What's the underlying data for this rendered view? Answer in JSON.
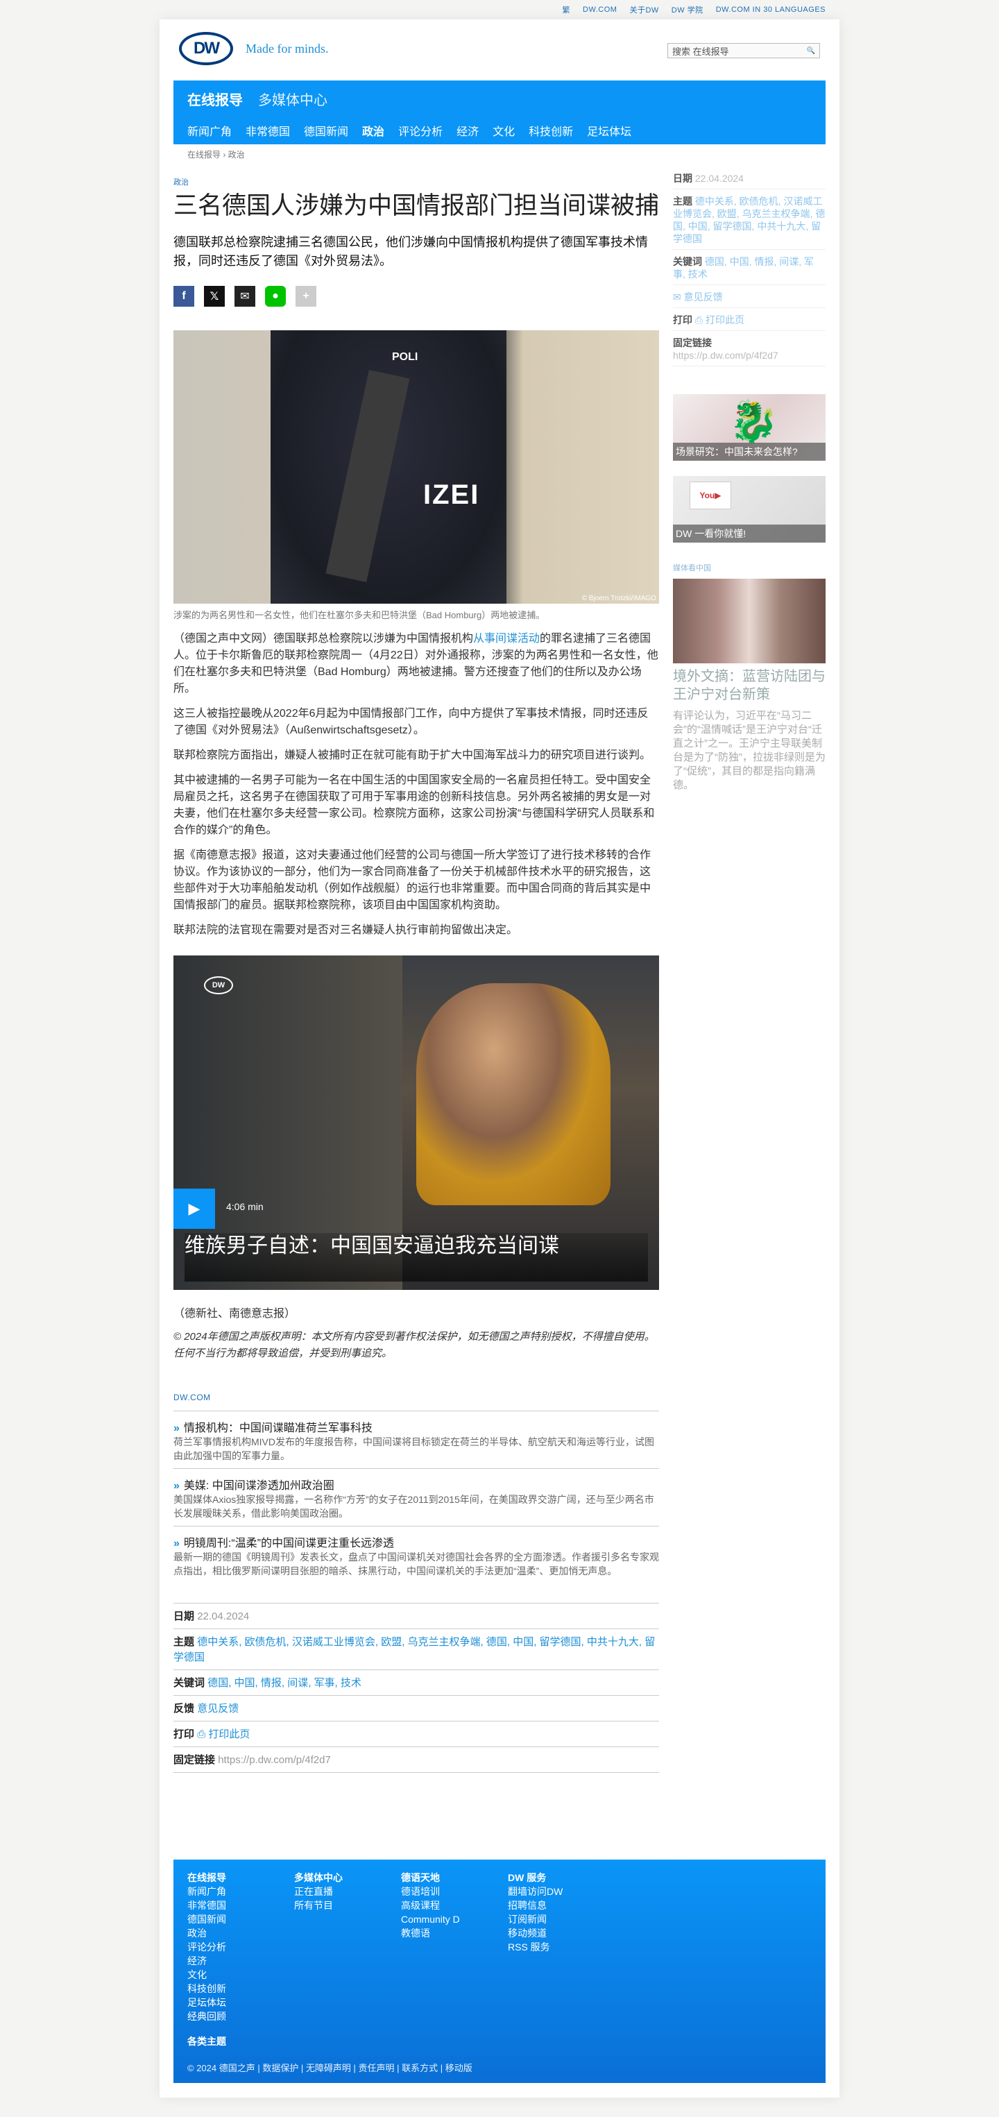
{
  "topbar": [
    "繁",
    "DW.COM",
    "关于DW",
    "DW 学院",
    "DW.COM IN 30 LANGUAGES"
  ],
  "header": {
    "logo": "DW",
    "tagline": "Made for minds.",
    "search_placeholder": "搜索 在线报导",
    "search_icon": "🔍"
  },
  "nav": {
    "top": [
      "在线报导",
      "多媒体中心"
    ],
    "bottom": [
      "新闻广角",
      "非常德国",
      "德国新闻",
      "政治",
      "评论分析",
      "经济",
      "文化",
      "科技创新",
      "足坛体坛"
    ]
  },
  "breadcrumb": "在线报导 › 政治",
  "article": {
    "category": "政治",
    "title": "三名德国人涉嫌为中国情报部门担当间谍被捕",
    "lead": "德国联邦总检察院逮捕三名德国公民，他们涉嫌向中国情报机构提供了德国军事技术情报，同时还违反了德国《对外贸易法》。",
    "photo_caption": "涉案的为两名男性和一名女性，他们在杜塞尔多夫和巴特洪堡（Bad Homburg）两地被逮捕。",
    "photo_credit": "© Bjoern Trotzki/IMAGO",
    "photo_text1": "POLI",
    "photo_text2": "IZEI",
    "p1a": "（德国之声中文网）德国联邦总检察院以涉嫌为中国情报机构",
    "p1link": "从事间谍活动",
    "p1b": "的罪名逮捕了三名德国人。位于卡尔斯鲁厄的联邦检察院周一（4月22日）对外通报称，涉案的为两名男性和一名女性，他们在杜塞尔多夫和巴特洪堡（Bad Homburg）两地被逮捕。警方还搜查了他们的住所以及办公场所。",
    "p2": "这三人被指控最晚从2022年6月起为中国情报部门工作，向中方提供了军事技术情报，同时还违反了德国《对外贸易法》（Außenwirtschaftsgesetz）。",
    "p3": "联邦检察院方面指出，嫌疑人被捕时正在就可能有助于扩大中国海军战斗力的研究项目进行谈判。",
    "p4": "其中被逮捕的一名男子可能为一名在中国生活的中国国家安全局的一名雇员担任特工。受中国安全局雇员之托，这名男子在德国获取了可用于军事用途的创新科技信息。另外两名被捕的男女是一对夫妻，他们在杜塞尔多夫经营一家公司。检察院方面称，这家公司扮演“与德国科学研究人员联系和合作的媒介”的角色。",
    "p5": "据《南德意志报》报道，这对夫妻通过他们经营的公司与德国一所大学签订了进行技术移转的合作协议。作为该协议的一部分，他们为一家合同商准备了一份关于机械部件技术水平的研究报告，这些部件对于大功率船舶发动机（例如作战舰艇）的运行也非常重要。而中国合同商的背后其实是中国情报部门的雇员。据联邦检察院称，该项目由中国国家机构资助。",
    "p6": "联邦法院的法官现在需要对是否对三名嫌疑人执行审前拘留做出决定。",
    "video_badge": "DW",
    "video_duration": "4:06 min",
    "video_title": "维族男子自述：中国国安逼迫我充当间谍",
    "play_icon": "▶",
    "source": "（德新社、南德意志报）",
    "copyright_line": "© 2024年德国之声版权声明：本文所有内容受到著作权法保护，如无德国之声特别授权，不得擅自使用。任何不当行为都将导致追偿，并受到刑事追究。"
  },
  "share_icons": [
    {
      "name": "facebook-icon",
      "glyph": "f",
      "color": "#3b5998"
    },
    {
      "name": "x-icon",
      "glyph": "𝕏",
      "color": "#111111"
    },
    {
      "name": "email-icon",
      "glyph": "✉",
      "color": "#222222"
    },
    {
      "name": "line-icon",
      "glyph": "●",
      "color": "#00c300"
    },
    {
      "name": "more-icon",
      "glyph": "+",
      "color": "#cccccc"
    }
  ],
  "dw_label": "DW.COM",
  "related": [
    {
      "title": "情报机构：中国间谍瞄准荷兰军事科技",
      "desc": "荷兰军事情报机构MIVD发布的年度报告称，中国间谍将目标锁定在荷兰的半导体、航空航天和海运等行业，试图由此加强中国的军事力量。"
    },
    {
      "title": "美媒: 中国间谍渗透加州政治圈",
      "desc": "美国媒体Axios独家报导揭露，一名称作“方芳”的女子在2011到2015年间，在美国政界交游广阔，还与至少两名市长发展暧昧关系，借此影响美国政治圈。"
    },
    {
      "title": "明镜周刊:“温柔”的中国间谍更注重长远渗透",
      "desc": "最新一期的德国《明镜周刊》发表长文，盘点了中国间谍机关对德国社会各界的全方面渗透。作者援引多名专家观点指出，相比俄罗斯间谍明目张胆的暗杀、抹黑行动，中国间谍机关的手法更加“温柔”、更加悄无声息。"
    }
  ],
  "meta": {
    "date_label": "日期",
    "date": "22.04.2024",
    "topics_label": "主题",
    "topics": "德中关系, 欧债危机, 汉诺威工业博览会, 欧盟, 乌克兰主权争端, 德国, 中国, 留学德国, 中共十九大, 留学德国",
    "keywords_label": "关键词",
    "keywords": "德国, 中国, 情报, 间谍, 军事, 技术",
    "feedback_label": "反馈",
    "feedback": "意见反馈",
    "print_label": "打印",
    "print": "打印此页",
    "link_label": "固定链接",
    "link": "https://p.dw.com/p/4f2d7"
  },
  "sidebar": {
    "date_label": "日期",
    "date": "22.04.2024",
    "topics_label": "主题",
    "topics": "德中关系, 欧债危机, 汉诺威工业博览会, 欧盟, 乌克兰主权争端, 德国, 中国, 留学德国, 中共十九大, 留学德国",
    "keywords_label": "关键词",
    "keywords": "德国, 中国, 情报, 间谍, 军事, 技术",
    "feedback": "意见反馈",
    "print_label": "打印",
    "print": "打印此页",
    "link_label": "固定链接",
    "link": "https://p.dw.com/p/4f2d7",
    "teaser1": "场景研究：中国未来会怎样?",
    "teaser2": "DW 一看你就懂!",
    "media_tag": "媒体看中国",
    "feature_title": "境外文摘：蓝营访陆团与王沪宁对台新策",
    "feature_desc": "有评论认为，习近平在“马习二会”的“温情喊话”是王沪宁对台“迁直之计”之一。王沪宁主导联美制台是为了“防独”，拉拢非绿则是为了“促统”，其目的都是指向籍满德。"
  },
  "footer": {
    "cols": [
      {
        "head": "在线报导",
        "items": [
          "新闻广角",
          "非常德国",
          "德国新闻",
          "政治",
          "评论分析",
          "经济",
          "文化",
          "科技创新",
          "足坛体坛",
          "经典回顾"
        ]
      },
      {
        "head": "多媒体中心",
        "items": [
          "正在直播",
          "所有节目"
        ]
      },
      {
        "head": "德语天地",
        "items": [
          "德语培训",
          "高级课程",
          "Community D",
          "教德语"
        ]
      },
      {
        "head": "DW 服务",
        "items": [
          "翻墙访问DW",
          "招聘信息",
          "订阅新闻",
          "移动频道",
          "RSS 服务"
        ]
      }
    ],
    "sub": "各类主题",
    "bottom": "© 2024 德国之声 | 数据保护 | 无障碍声明 | 责任声明 | 联系方式 | 移动版"
  }
}
